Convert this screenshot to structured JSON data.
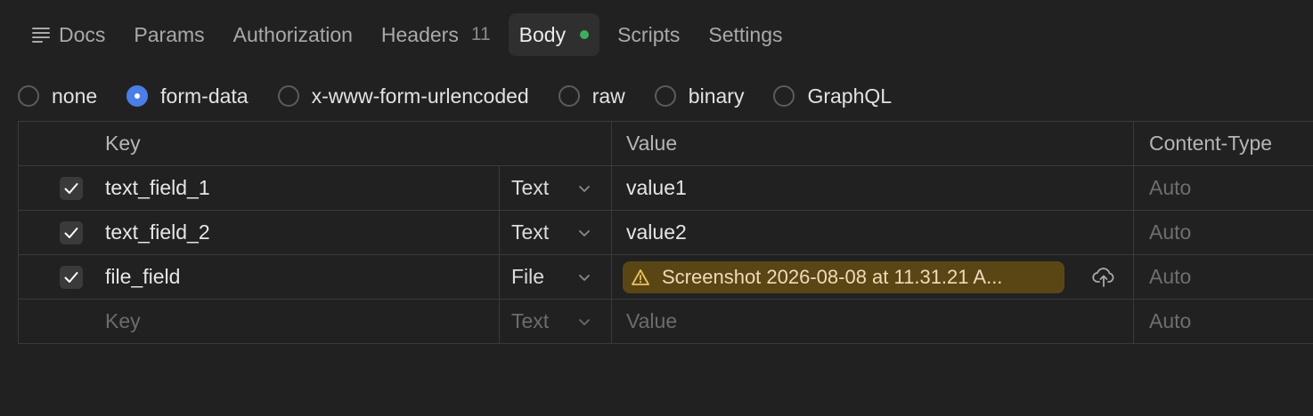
{
  "tabs": [
    {
      "label": "Docs",
      "icon": "docs-lines-icon"
    },
    {
      "label": "Params"
    },
    {
      "label": "Authorization"
    },
    {
      "label": "Headers",
      "count": "11"
    },
    {
      "label": "Body",
      "active": true,
      "status_dot_color": "#3fae5b"
    },
    {
      "label": "Scripts"
    },
    {
      "label": "Settings"
    }
  ],
  "body_modes": [
    {
      "label": "none",
      "checked": false
    },
    {
      "label": "form-data",
      "checked": true
    },
    {
      "label": "x-www-form-urlencoded",
      "checked": false
    },
    {
      "label": "raw",
      "checked": false
    },
    {
      "label": "binary",
      "checked": false
    },
    {
      "label": "GraphQL",
      "checked": false
    }
  ],
  "table": {
    "columns": {
      "key": "Key",
      "value": "Value",
      "content_type": "Content-Type"
    },
    "rows": [
      {
        "checked": true,
        "key": "text_field_1",
        "type": "Text",
        "value": "value1",
        "content_type": "Auto"
      },
      {
        "checked": true,
        "key": "text_field_2",
        "type": "Text",
        "value": "value2",
        "content_type": "Auto"
      },
      {
        "checked": true,
        "key": "file_field",
        "type": "File",
        "file_name": "Screenshot 2026-08-08 at 11.31.21 A...",
        "file_warning": true,
        "content_type": "Auto"
      }
    ],
    "new_row": {
      "key_placeholder": "Key",
      "type": "Text",
      "value_placeholder": "Value",
      "content_type": "Auto"
    }
  },
  "colors": {
    "accent": "#4a7ee8",
    "warning_chip_bg": "#5a4615",
    "background": "#212121"
  }
}
